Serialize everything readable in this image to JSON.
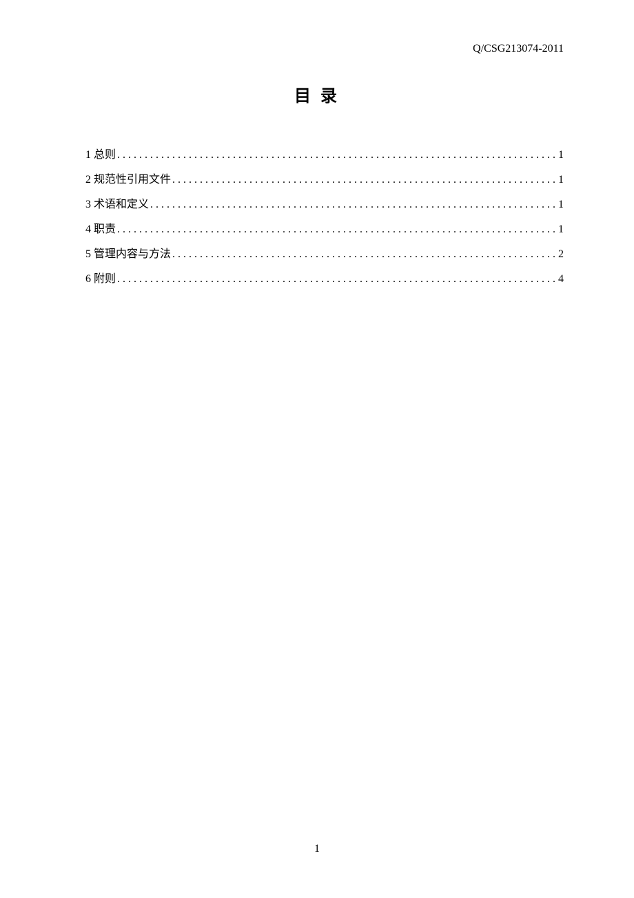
{
  "header": {
    "doc_code": "Q/CSG213074-2011"
  },
  "title": "目 录",
  "toc": [
    {
      "num": "1",
      "label": "总则",
      "page": "1"
    },
    {
      "num": "2",
      "label": "规范性引用文件",
      "page": "1"
    },
    {
      "num": "3",
      "label": "术语和定义",
      "page": "1"
    },
    {
      "num": "4",
      "label": "职责",
      "page": "1"
    },
    {
      "num": "5",
      "label": "管理内容与方法",
      "page": "2"
    },
    {
      "num": "6",
      "label": "附则",
      "page": "4"
    }
  ],
  "page_number": "1"
}
